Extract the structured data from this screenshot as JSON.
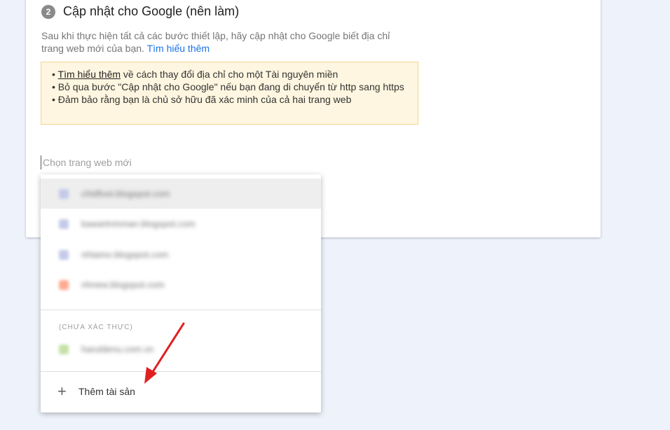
{
  "step": {
    "number": "2",
    "title": "Cập nhật cho Google (nên làm)"
  },
  "description": {
    "text": "Sau khi thực hiện tất cả các bước thiết lập, hãy cập nhật cho Google biết địa chỉ trang web mới của bạn.",
    "link": "Tìm hiểu thêm"
  },
  "tips": {
    "line1_bullet": "• ",
    "line1_link": "Tìm hiểu thêm",
    "line1_rest": " về cách thay đổi địa chỉ cho một Tài nguyên miền",
    "line2": "• Bỏ qua bước \"Cập nhật cho Google\" nếu bạn đang di chuyển từ http sang https",
    "line3": "• Đảm bảo rằng bạn là chủ sở hữu đã xác minh của cả hai trang web"
  },
  "site_picker": {
    "placeholder": "Chọn trang web mới"
  },
  "dropdown": {
    "verified_items": [
      {
        "label": "chidfoot.blogspot.com",
        "icon": "blogger-icon",
        "color": "#c5cae9"
      },
      {
        "label": "kawartnmman.blogspot.com",
        "icon": "blogger-icon",
        "color": "#c5cae9"
      },
      {
        "label": "nhtamo.blogspot.com",
        "icon": "blogger-icon",
        "color": "#c5cae9"
      },
      {
        "label": "nhnew.blogspot.com",
        "icon": "site-icon",
        "color": "#ffab91"
      }
    ],
    "unverified_header": "(CHƯA XÁC THỰC)",
    "unverified_items": [
      {
        "label": "haruldenu.com.vn",
        "icon": "site-icon",
        "color": "#c5e1a5"
      }
    ],
    "add_label": "Thêm tài sản",
    "add_icon": "plus-icon"
  },
  "colors": {
    "link": "#1a73e8",
    "arrow": "#e02020",
    "tips_bg": "#fef6e0",
    "tips_border": "#f6d48c"
  }
}
